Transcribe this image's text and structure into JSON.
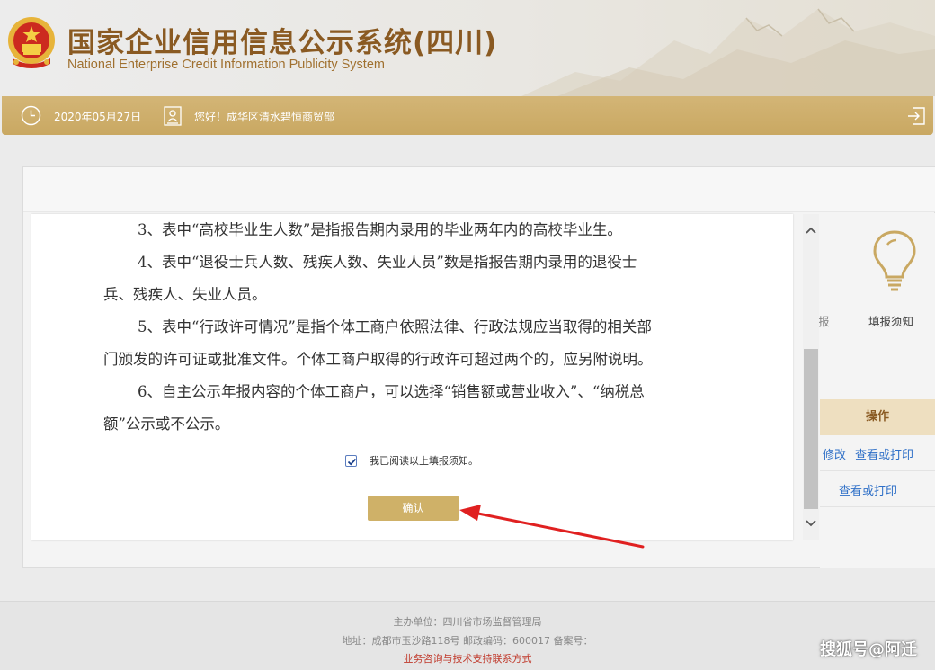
{
  "header": {
    "title_cn": "国家企业信用信息公示系统(四川)",
    "title_en": "National Enterprise Credit Information Publicity System"
  },
  "infobar": {
    "date": "2020年05月27日",
    "greeting": "您好！成华区清水碧恒商贸部"
  },
  "side": {
    "partial_label": "报",
    "guide_label": "填报须知",
    "op_header": "操作",
    "row1_links": [
      "修改",
      "查看或打印"
    ],
    "row2_links": [
      "查看或打印"
    ]
  },
  "modal": {
    "paragraphs": [
      [
        "3、表中“高校毕业生人数”是指报告期内录用的毕业两年内的高校毕业生。"
      ],
      [
        "4、表中“退役士兵人数、残疾人数、失业人员”数是指报告期内录用的退役士",
        "兵、残疾人、失业人员。"
      ],
      [
        "5、表中“行政许可情况”是指个体工商户依照法律、行政法规应当取得的相关部",
        "门颁发的许可证或批准文件。个体工商户取得的行政许可超过两个的，应另附说明。"
      ],
      [
        "6、自主公示年报内容的个体工商户，可以选择“销售额或营业收入”、“纳税总",
        "额”公示或不公示。"
      ]
    ],
    "checkbox_label": "我已阅读以上填报须知。",
    "checkbox_checked": true,
    "confirm_label": "确认"
  },
  "footer": {
    "line1": "主办单位：四川省市场监督管理局",
    "line2": "地址：成都市玉沙路118号 邮政编码：600017 备案号：",
    "line3": "业务咨询与技术支持联系方式"
  },
  "watermark": "搜狐号@阿迁",
  "colors": {
    "brand_gold": "#c9a862",
    "title_brown": "#8a5a22",
    "link_blue": "#2e6fc7",
    "arrow_red": "#e02020"
  }
}
